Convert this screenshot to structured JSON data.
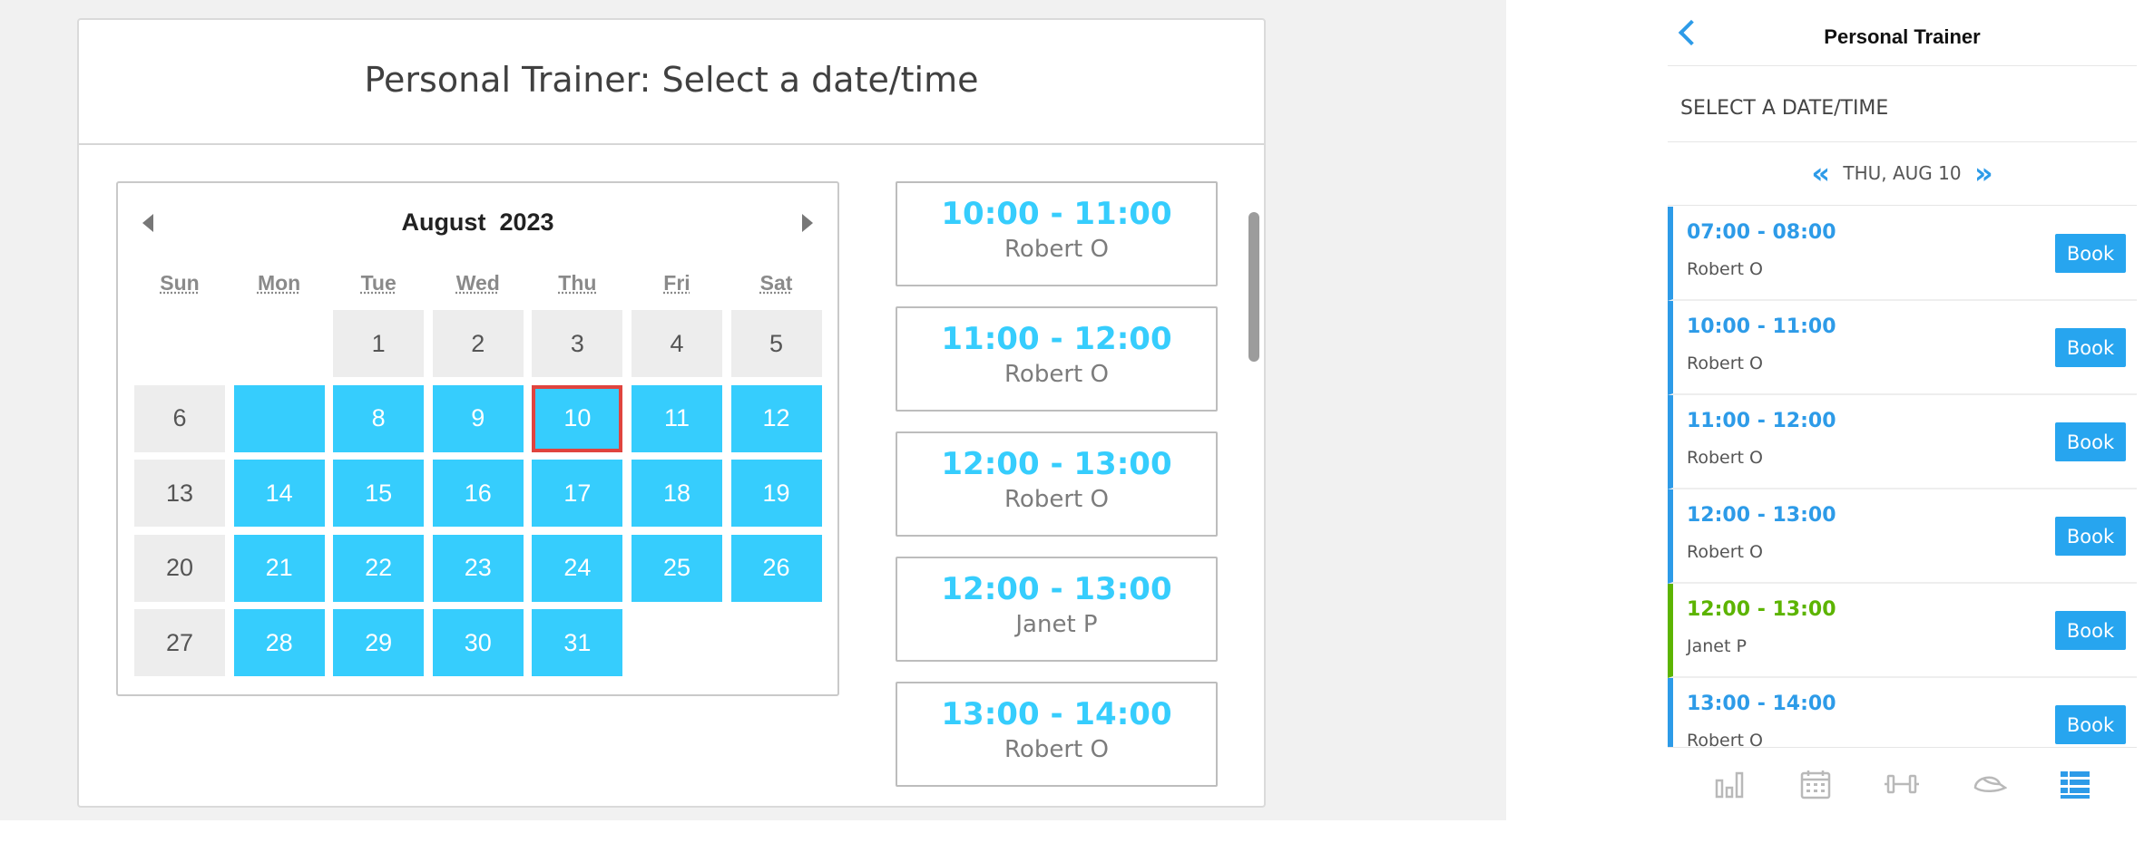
{
  "web": {
    "title": "Personal Trainer: Select a date/time",
    "calendar": {
      "month": "August",
      "year": "2023",
      "weekdays": [
        "Sun",
        "Mon",
        "Tue",
        "Wed",
        "Thu",
        "Fri",
        "Sat"
      ],
      "days": [
        {
          "label": "",
          "state": "empty"
        },
        {
          "label": "",
          "state": "empty"
        },
        {
          "label": "1",
          "state": "grey"
        },
        {
          "label": "2",
          "state": "grey"
        },
        {
          "label": "3",
          "state": "grey"
        },
        {
          "label": "4",
          "state": "grey"
        },
        {
          "label": "5",
          "state": "grey"
        },
        {
          "label": "6",
          "state": "grey"
        },
        {
          "label": "",
          "state": "blue"
        },
        {
          "label": "8",
          "state": "blue"
        },
        {
          "label": "9",
          "state": "blue"
        },
        {
          "label": "10",
          "state": "selected"
        },
        {
          "label": "11",
          "state": "blue"
        },
        {
          "label": "12",
          "state": "blue"
        },
        {
          "label": "13",
          "state": "grey"
        },
        {
          "label": "14",
          "state": "blue"
        },
        {
          "label": "15",
          "state": "blue"
        },
        {
          "label": "16",
          "state": "blue"
        },
        {
          "label": "17",
          "state": "blue"
        },
        {
          "label": "18",
          "state": "blue"
        },
        {
          "label": "19",
          "state": "blue"
        },
        {
          "label": "20",
          "state": "grey"
        },
        {
          "label": "21",
          "state": "blue"
        },
        {
          "label": "22",
          "state": "blue"
        },
        {
          "label": "23",
          "state": "blue"
        },
        {
          "label": "24",
          "state": "blue"
        },
        {
          "label": "25",
          "state": "blue"
        },
        {
          "label": "26",
          "state": "blue"
        },
        {
          "label": "27",
          "state": "grey"
        },
        {
          "label": "28",
          "state": "blue"
        },
        {
          "label": "29",
          "state": "blue"
        },
        {
          "label": "30",
          "state": "blue"
        },
        {
          "label": "31",
          "state": "blue"
        },
        {
          "label": "",
          "state": "empty"
        },
        {
          "label": "",
          "state": "empty"
        }
      ]
    },
    "slots": [
      {
        "time": "10:00 - 11:00",
        "trainer": "Robert O"
      },
      {
        "time": "11:00 - 12:00",
        "trainer": "Robert O"
      },
      {
        "time": "12:00 - 13:00",
        "trainer": "Robert O"
      },
      {
        "time": "12:00 - 13:00",
        "trainer": "Janet P"
      },
      {
        "time": "13:00 - 14:00",
        "trainer": "Robert O"
      }
    ]
  },
  "mobile": {
    "title": "Personal Trainer",
    "subtitle": "SELECT A DATE/TIME",
    "date_label": "THU, AUG 10",
    "book_label": "Book",
    "items": [
      {
        "time": "07:00 - 08:00",
        "trainer": "Robert O",
        "color": "#2d9be8"
      },
      {
        "time": "10:00 - 11:00",
        "trainer": "Robert O",
        "color": "#2d9be8"
      },
      {
        "time": "11:00 - 12:00",
        "trainer": "Robert O",
        "color": "#2d9be8"
      },
      {
        "time": "12:00 - 13:00",
        "trainer": "Robert O",
        "color": "#2d9be8"
      },
      {
        "time": "12:00 - 13:00",
        "trainer": "Janet P",
        "color": "#5cb400"
      },
      {
        "time": "13:00 - 14:00",
        "trainer": "Robert O",
        "color": "#2d9be8"
      }
    ],
    "tabs": [
      "chart-icon",
      "calendar-icon",
      "dumbbell-icon",
      "cap-icon",
      "list-icon"
    ]
  },
  "colors": {
    "accent": "#36cdfd",
    "mobile_accent": "#2d9be8",
    "green": "#5cb400",
    "selected_outline": "#e0443e"
  }
}
